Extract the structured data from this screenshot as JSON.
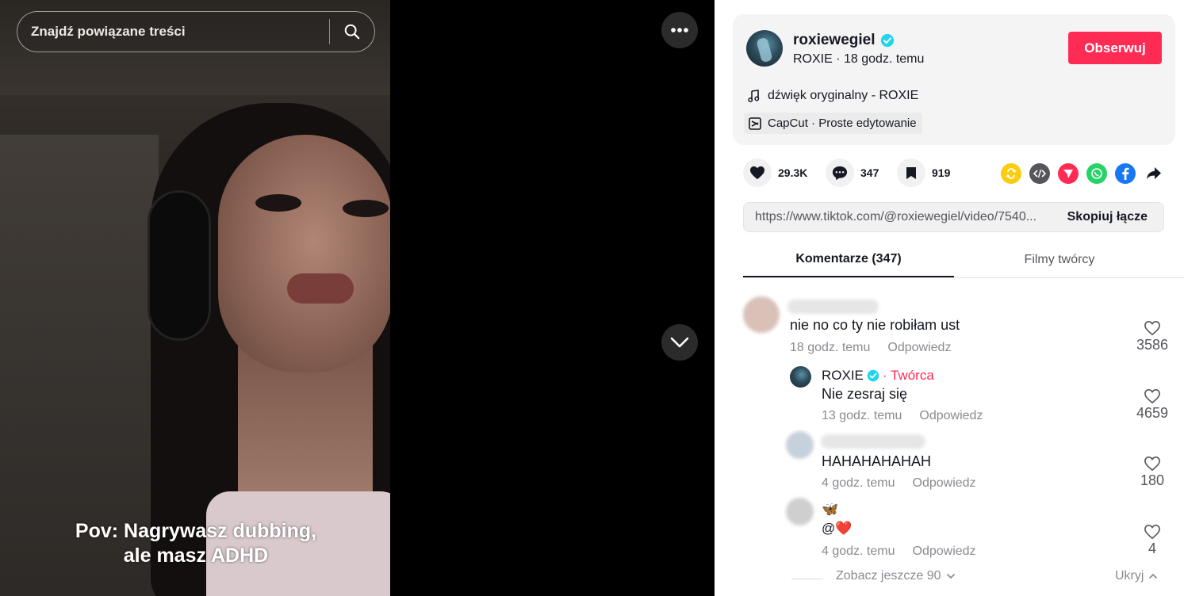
{
  "search": {
    "placeholder": "Znajdź powiązane treści"
  },
  "video": {
    "caption_line1": "Pov: Nagrywasz dubbing,",
    "caption_line2": "ale masz ADHD"
  },
  "author": {
    "username": "roxiewegiel",
    "display_name": "ROXIE",
    "posted": "18 godz. temu",
    "sub_line": "ROXIE · 18 godz. temu",
    "follow_label": "Obserwuj",
    "music": "dźwięk oryginalny - ROXIE",
    "capcut": "CapCut · Proste edytowanie"
  },
  "stats": {
    "likes": "29.3K",
    "comments": "347",
    "saves": "919"
  },
  "share_icons": [
    "repost-icon",
    "embed-icon",
    "send-icon",
    "whatsapp-icon",
    "facebook-icon",
    "share-arrow-icon"
  ],
  "link": {
    "url": "https://www.tiktok.com/@roxiewegiel/video/7540...",
    "copy_label": "Skopiuj łącze"
  },
  "tabs": {
    "comments": "Komentarze (347)",
    "creator_videos": "Filmy twórcy"
  },
  "comments": [
    {
      "text": "nie no co ty nie robiłam ust",
      "time": "18 godz. temu",
      "reply": "Odpowiedz",
      "likes": "3586"
    },
    {
      "author": "ROXIE",
      "creator_tag": "· Twórca",
      "text": "Nie zesraj się",
      "time": "13 godz. temu",
      "reply": "Odpowiedz",
      "likes": "4659"
    },
    {
      "text": "HAHAHAHAHAH",
      "time": "4 godz. temu",
      "reply": "Odpowiedz",
      "likes": "180"
    },
    {
      "text_line1": "🦋",
      "text_line2": "@❤️",
      "time": "4 godz. temu",
      "reply": "Odpowiedz",
      "likes": "4"
    }
  ],
  "see_more": "Zobacz jeszcze 90",
  "hide": "Ukryj",
  "colors": {
    "accent": "#fe2c55",
    "verified": "#20d5ec",
    "text": "#161823",
    "muted": "#8a8b91"
  }
}
